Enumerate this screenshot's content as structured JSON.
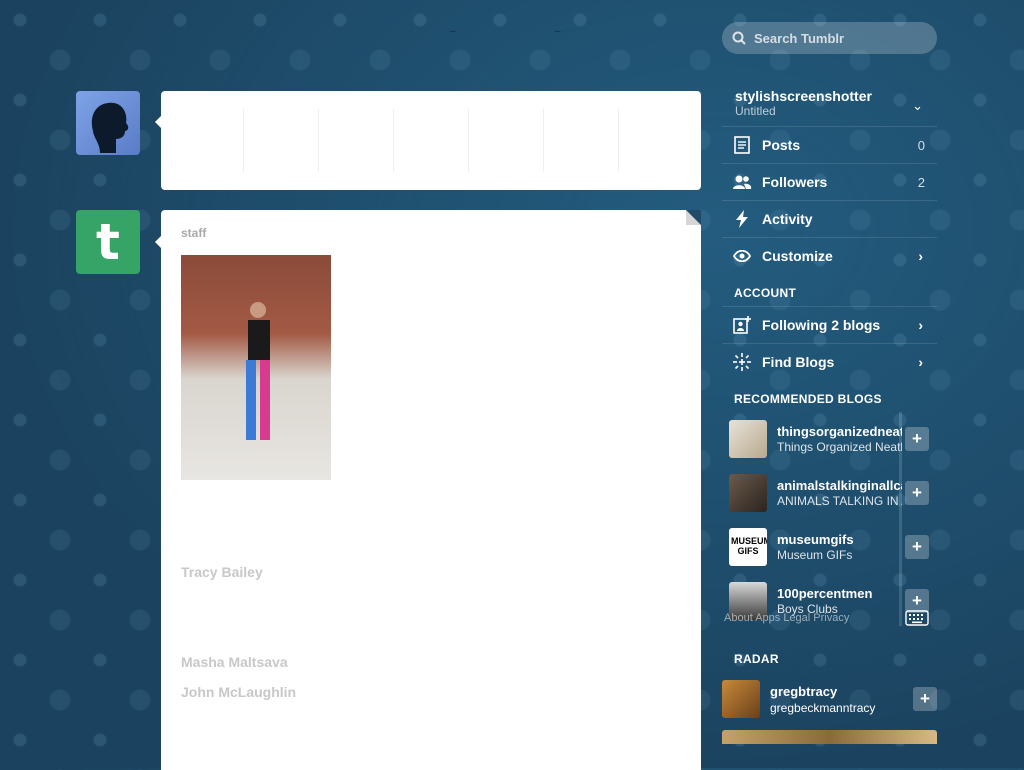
{
  "search": {
    "placeholder": "Search Tumblr"
  },
  "composer": {
    "slots": [
      "",
      "",
      "",
      "",
      "",
      "",
      ""
    ]
  },
  "post": {
    "author": "staff",
    "credits": [
      "Tracy Bailey",
      "Masha Maltsava",
      "John McLaughlin"
    ]
  },
  "sidebar": {
    "blog": {
      "name": "stylishscreenshotter",
      "title": "Untitled"
    },
    "nav": [
      {
        "label": "Posts",
        "count": "0",
        "icon": "posts-icon"
      },
      {
        "label": "Followers",
        "count": "2",
        "icon": "followers-icon"
      },
      {
        "label": "Activity",
        "icon": "activity-icon"
      },
      {
        "label": "Customize",
        "icon": "eye-icon"
      }
    ],
    "account_title": "ACCOUNT",
    "account": [
      {
        "label": "Following 2 blogs",
        "icon": "following-icon"
      },
      {
        "label": "Find Blogs",
        "icon": "find-blogs-icon"
      }
    ],
    "recommended_title": "RECOMMENDED BLOGS",
    "recommended": [
      {
        "name": "thingsorganizedneatly",
        "desc": "Things Organized Neatly"
      },
      {
        "name": "animalstalkinginallcaps",
        "desc": "ANIMALS TALKING IN ALL CAPS"
      },
      {
        "name": "museumgifs",
        "desc": "Museum GIFs",
        "thumb_text": "MUSEUM GIFS"
      },
      {
        "name": "100percentmen",
        "desc": "Boys Clubs"
      }
    ],
    "footer_overlay": "About  Apps  Legal  Privacy",
    "radar_title": "RADAR",
    "radar": {
      "name": "gregbtracy",
      "desc": "gregbeckmanntracy"
    }
  },
  "colors": {
    "background": "#1f4a68",
    "staff_green": "#35a466"
  }
}
